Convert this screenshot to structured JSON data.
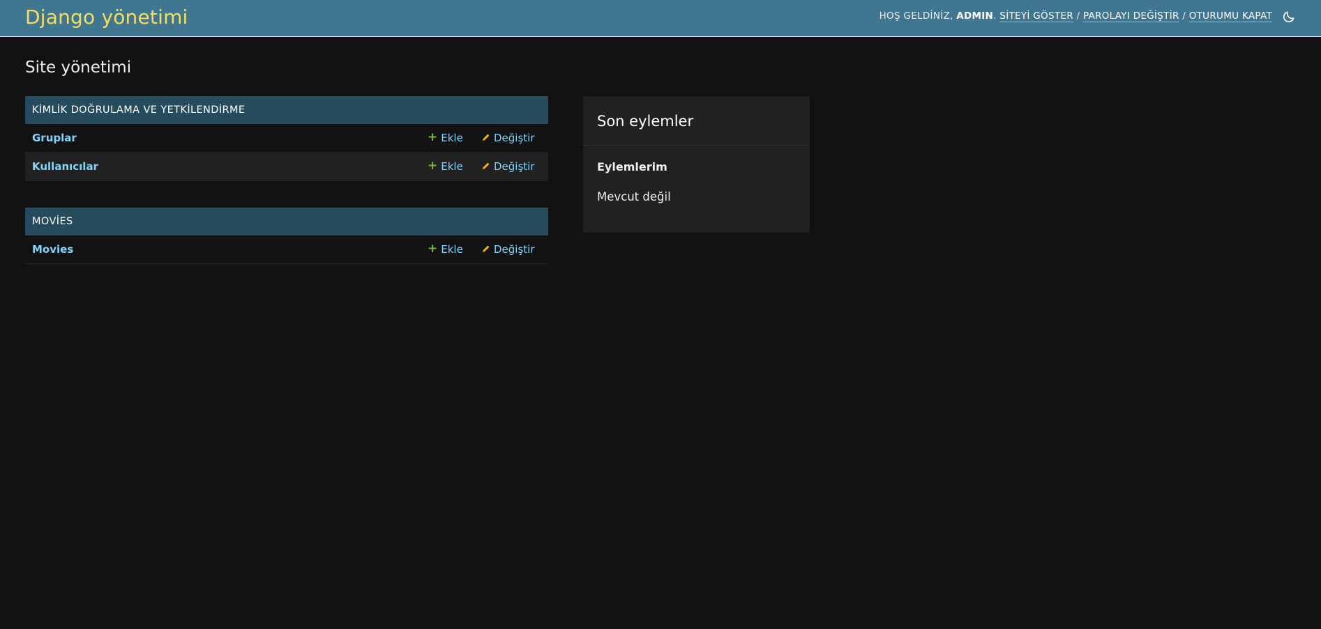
{
  "header": {
    "branding": "Django yönetimi",
    "welcome": "HOŞ GELDİNİZ,",
    "username": "ADMIN",
    "username_suffix": ".",
    "view_site": "SİTEYİ GÖSTER",
    "change_password": "PAROLAYI DEĞİŞTİR",
    "logout": "OTURUMU KAPAT",
    "separator": "/",
    "theme_icon": "moon-icon"
  },
  "page": {
    "title": "Site yönetimi"
  },
  "modules": [
    {
      "caption": "KİMLİK DOĞRULAMA VE YETKİLENDİRME",
      "models": [
        {
          "name": "Gruplar",
          "add": "Ekle",
          "change": "Değiştir"
        },
        {
          "name": "Kullanıcılar",
          "add": "Ekle",
          "change": "Değiştir"
        }
      ]
    },
    {
      "caption": "MOVİES",
      "models": [
        {
          "name": "Movies",
          "add": "Ekle",
          "change": "Değiştir"
        }
      ]
    }
  ],
  "recent_actions": {
    "title": "Son eylemler",
    "subtitle": "Eylemlerim",
    "empty": "Mevcut değil"
  },
  "colors": {
    "header_bg": "#417690",
    "branding": "#f5dd5d",
    "module_caption_bg": "#264b5d",
    "link": "#81d4fa",
    "add_icon": "#70bf2b",
    "change_icon": "#efb80b",
    "page_bg": "#121212"
  }
}
